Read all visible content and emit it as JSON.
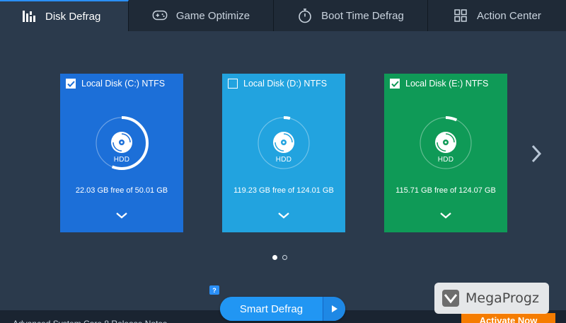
{
  "tabs": [
    {
      "label": "Disk Defrag",
      "icon": "bars-icon",
      "active": true
    },
    {
      "label": "Game Optimize",
      "icon": "gamepad-icon",
      "active": false
    },
    {
      "label": "Boot Time Defrag",
      "icon": "stopwatch-icon",
      "active": false
    },
    {
      "label": "Action Center",
      "icon": "grid-icon",
      "active": false
    }
  ],
  "disks": [
    {
      "name": "Local Disk (C:) NTFS",
      "checked": true,
      "type": "HDD",
      "free": "22.03 GB free of 50.01 GB",
      "used_fraction": 0.56,
      "color": "#1c6fd8"
    },
    {
      "name": "Local Disk (D:) NTFS",
      "checked": false,
      "type": "HDD",
      "free": "119.23 GB free of 124.01 GB",
      "used_fraction": 0.04,
      "color": "#22a3df"
    },
    {
      "name": "Local Disk (E:) NTFS",
      "checked": true,
      "type": "HDD",
      "free": "115.71 GB free of 124.07 GB",
      "used_fraction": 0.07,
      "color": "#0f9a57"
    }
  ],
  "pager": {
    "pages": 2,
    "current": 1
  },
  "help_badge": "?",
  "actions": {
    "smart_defrag": "Smart Defrag",
    "activate": "Activate Now"
  },
  "bottom_text": "Advanced System Care 8 Release Notes",
  "watermark": "MegaProgz",
  "colors": {
    "background": "#2b3a4c",
    "tabbar": "#1f2a37",
    "accent": "#2196f3",
    "activate": "#f57c00"
  }
}
